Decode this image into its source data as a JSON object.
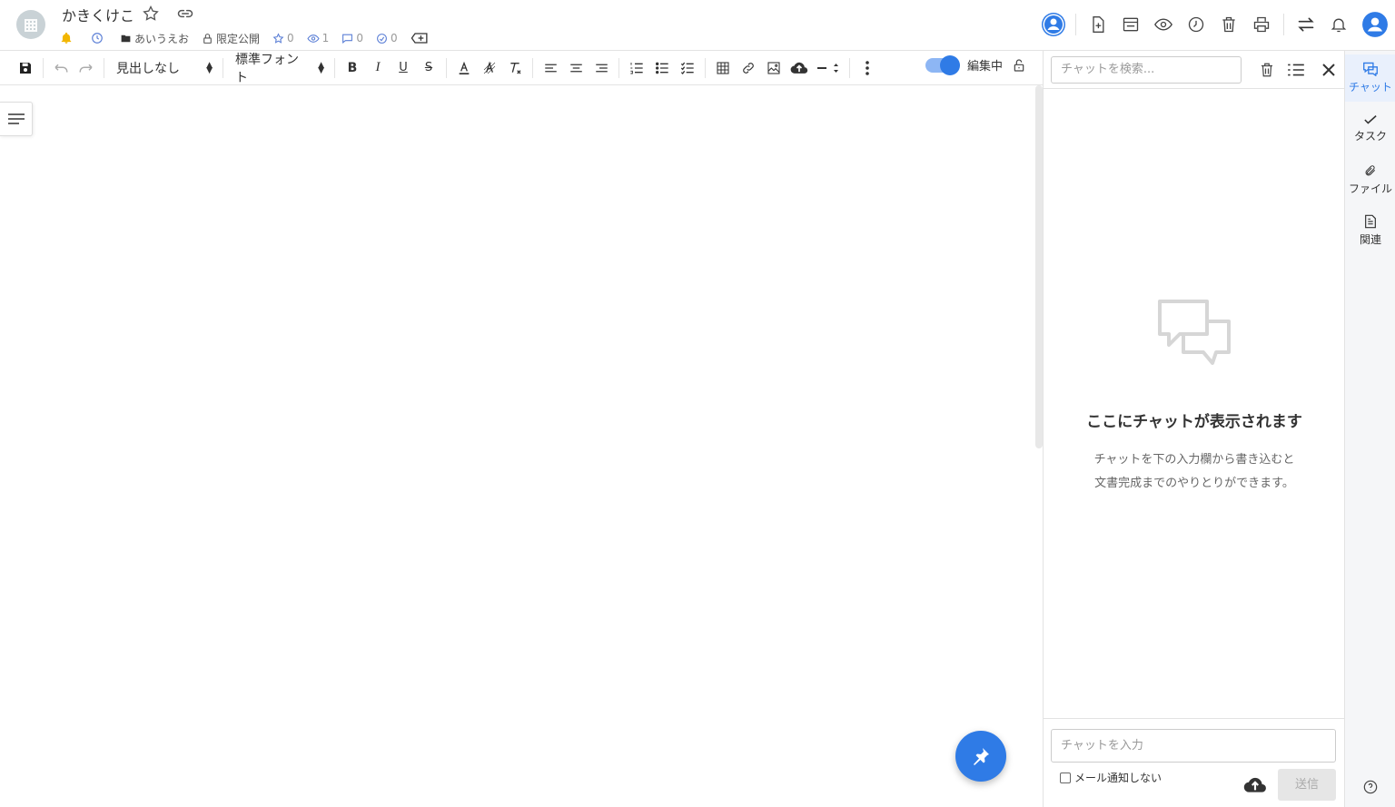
{
  "header": {
    "title": "かきくけこ",
    "folder": "あいうえお",
    "visibility": "限定公開",
    "stars": "0",
    "views": "1",
    "comments": "0",
    "checks": "0"
  },
  "toolbar": {
    "heading_select": "見出しなし",
    "font_select": "標準フォント",
    "edit_mode_label": "編集中"
  },
  "chat": {
    "search_placeholder": "チャットを検索...",
    "empty_title": "ここにチャットが表示されます",
    "empty_desc_line1": "チャットを下の入力欄から書き込むと",
    "empty_desc_line2": "文書完成までのやりとりができます。",
    "input_placeholder": "チャットを入力",
    "mail_option": "メール通知しない",
    "send_label": "送信"
  },
  "rail": {
    "items": [
      {
        "label": "チャット",
        "icon": "chat-icon",
        "active": true
      },
      {
        "label": "タスク",
        "icon": "check-icon"
      },
      {
        "label": "ファイル",
        "icon": "paperclip-icon"
      },
      {
        "label": "関連",
        "icon": "document-icon"
      }
    ]
  },
  "colors": {
    "accent": "#2f7be6",
    "bell": "#f2b600"
  }
}
